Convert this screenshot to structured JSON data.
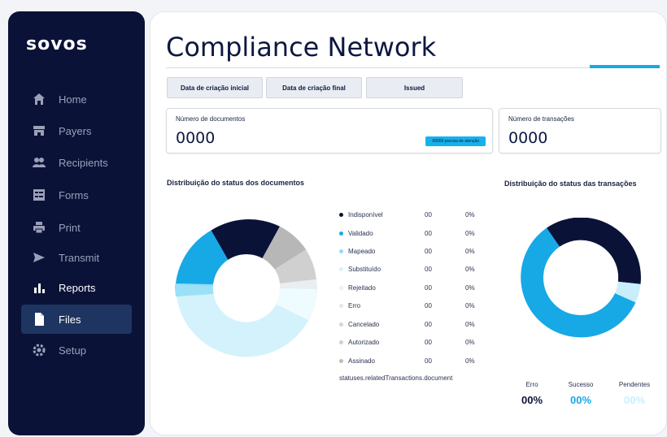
{
  "sidebar": {
    "logo": "sovos",
    "items": [
      {
        "label": "Home",
        "icon": "home-icon"
      },
      {
        "label": "Payers",
        "icon": "store-icon"
      },
      {
        "label": "Recipients",
        "icon": "people-icon"
      },
      {
        "label": "Forms",
        "icon": "form-icon"
      },
      {
        "label": "Print",
        "icon": "printer-icon"
      },
      {
        "label": "Transmit",
        "icon": "send-icon"
      },
      {
        "label": "Reports",
        "icon": "bar-chart-icon"
      },
      {
        "label": "Files",
        "icon": "file-icon"
      },
      {
        "label": "Setup",
        "icon": "gear-icon"
      }
    ],
    "active": "Files"
  },
  "main": {
    "title": "Compliance Network",
    "filters": [
      "Data de criação inicial",
      "Data de criação final",
      "Issued"
    ],
    "documents_card": {
      "label": "Número de documentos",
      "value": "0000",
      "pill": "00000 precisa de atenção"
    },
    "transactions_card": {
      "label": "Número de transações",
      "value": "0000"
    },
    "doc_status": {
      "title": "Distribuição do status dos documentos",
      "rows": [
        {
          "label": "Indisponível",
          "count": "00",
          "pct": "0%",
          "color": "#0b1238"
        },
        {
          "label": "Validado",
          "count": "00",
          "pct": "0%",
          "color": "#17a8e6"
        },
        {
          "label": "Mapeado",
          "count": "00",
          "pct": "0%",
          "color": "#8fdcf6"
        },
        {
          "label": "Substituído",
          "count": "00",
          "pct": "0%",
          "color": "#d4f2fb"
        },
        {
          "label": "Rejeitado",
          "count": "00",
          "pct": "0%",
          "color": "#eef3f5"
        },
        {
          "label": "Erro",
          "count": "00",
          "pct": "0%",
          "color": "#e6e6e6"
        },
        {
          "label": "Cancelado",
          "count": "00",
          "pct": "0%",
          "color": "#d5d5d5"
        },
        {
          "label": "Autorizado",
          "count": "00",
          "pct": "0%",
          "color": "#cfcfcf"
        },
        {
          "label": "Assinado",
          "count": "00",
          "pct": "0%",
          "color": "#bdbdbd"
        }
      ],
      "footer": "statuses.relatedTransactions.document"
    },
    "tx_status": {
      "title": "Distribuição do status das transações",
      "stats": [
        {
          "label": "Erro",
          "value": "00%",
          "color": "#0b1238"
        },
        {
          "label": "Sucesso",
          "value": "00%",
          "color": "#17a8e6"
        },
        {
          "label": "Pendentes",
          "value": "00%",
          "color": "#c9eefa"
        }
      ]
    }
  }
}
